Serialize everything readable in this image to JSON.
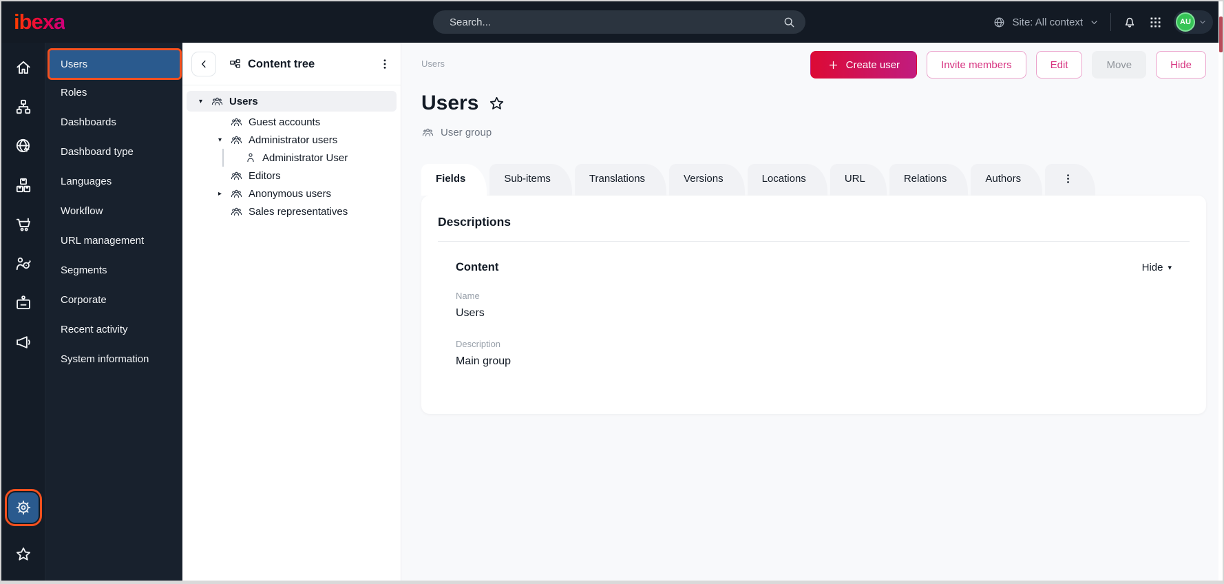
{
  "topbar": {
    "logo": "ibexa",
    "search_placeholder": "Search...",
    "site_context": "Site: All context",
    "avatar_initials": "AU"
  },
  "sidebar": {
    "rail_icons": [
      {
        "name": "home-icon"
      },
      {
        "name": "content-structure-icon"
      },
      {
        "name": "site-icon"
      },
      {
        "name": "products-icon"
      },
      {
        "name": "commerce-cart-icon"
      },
      {
        "name": "personalization-icon"
      },
      {
        "name": "corporate-badge-icon"
      },
      {
        "name": "marketing-megaphone-icon"
      }
    ],
    "bottom_icons": [
      {
        "name": "settings-gear-icon",
        "active": true
      },
      {
        "name": "bookmarks-star-icon",
        "active": false
      }
    ],
    "menu_items": [
      {
        "label": "Users",
        "active": true
      },
      {
        "label": "Roles",
        "active": false
      },
      {
        "label": "Dashboards",
        "active": false
      },
      {
        "label": "Dashboard type",
        "active": false
      },
      {
        "label": "Languages",
        "active": false
      },
      {
        "label": "Workflow",
        "active": false
      },
      {
        "label": "URL management",
        "active": false
      },
      {
        "label": "Segments",
        "active": false
      },
      {
        "label": "Corporate",
        "active": false
      },
      {
        "label": "Recent activity",
        "active": false
      },
      {
        "label": "System information",
        "active": false
      }
    ]
  },
  "content_tree": {
    "title": "Content tree",
    "nodes": [
      {
        "label": "Users",
        "depth": 0,
        "caret": "▾",
        "icon": "user-group",
        "selected": true
      },
      {
        "label": "Guest accounts",
        "depth": 1,
        "caret": "",
        "icon": "user-group",
        "selected": false
      },
      {
        "label": "Administrator users",
        "depth": 1,
        "caret": "▾",
        "icon": "user-group",
        "selected": false
      },
      {
        "label": "Administrator User",
        "depth": 2,
        "caret": "",
        "icon": "user",
        "selected": false
      },
      {
        "label": "Editors",
        "depth": 1,
        "caret": "",
        "icon": "user-group",
        "selected": false
      },
      {
        "label": "Anonymous users",
        "depth": 1,
        "caret": "▸",
        "icon": "user-group",
        "selected": false
      },
      {
        "label": "Sales representatives",
        "depth": 1,
        "caret": "",
        "icon": "user-group",
        "selected": false
      }
    ]
  },
  "main": {
    "breadcrumb": "Users",
    "actions": {
      "create_user": "Create user",
      "invite_members": "Invite members",
      "edit": "Edit",
      "move": "Move",
      "hide": "Hide"
    },
    "title": "Users",
    "content_type": "User group",
    "tabs": [
      {
        "label": "Fields",
        "active": true
      },
      {
        "label": "Sub-items",
        "active": false
      },
      {
        "label": "Translations",
        "active": false
      },
      {
        "label": "Versions",
        "active": false
      },
      {
        "label": "Locations",
        "active": false
      },
      {
        "label": "URL",
        "active": false
      },
      {
        "label": "Relations",
        "active": false
      },
      {
        "label": "Authors",
        "active": false
      }
    ],
    "card": {
      "heading": "Descriptions",
      "section_title": "Content",
      "collapse_label": "Hide",
      "collapse_chevron": "▾",
      "fields": [
        {
          "label": "Name",
          "value": "Users"
        },
        {
          "label": "Description",
          "value": "Main group"
        }
      ]
    }
  },
  "colors": {
    "topbar_bg": "#131a24",
    "menu_bg": "#18212d",
    "selected_blue": "#2a5a8e",
    "focus_orange": "#f4501e",
    "primary_gradient_start": "#dc0a35",
    "primary_gradient_end": "#c11c7f",
    "outline_pink_text": "#d6317f",
    "avatar_green": "#35c455",
    "main_bg": "#f8f9fb"
  }
}
